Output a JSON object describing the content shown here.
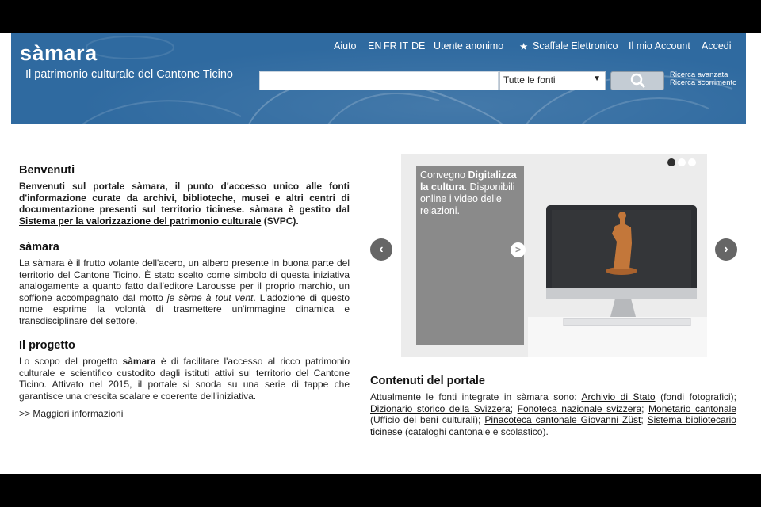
{
  "header": {
    "logo": "sàmara",
    "tagline": "Il patrimonio culturale del Cantone Ticino",
    "nav": {
      "aiuto": "Aiuto",
      "lang_en": "EN",
      "lang_fr": "FR",
      "lang_it": "IT",
      "lang_de": "DE",
      "user": "Utente anonimo",
      "shelf_icon": "★",
      "shelf": "Scaffale Elettronico",
      "account": "Il mio Account",
      "login": "Accedi"
    },
    "search": {
      "value": "",
      "source_selected": "Tutte le fonti",
      "advanced": "Ricerca avanzata",
      "browse": "Ricerca scorrimento"
    }
  },
  "intro": {
    "title": "Benvenuti",
    "text": "Benvenuti sul portale sàmara, il punto d'accesso unico alle fonti d'informazione curate da archivi, biblioteche, musei e altri centri di documentazione presenti sul territorio ticinese. sàmara è gestito dal",
    "link": "Sistema per la valorizzazione del patrimonio culturale",
    "suffix": " (SVPC)."
  },
  "samara": {
    "title": "sàmara",
    "text_a": "La sàmara è il frutto volante dell'acero, un albero presente in buona parte del territorio del Cantone Ticino. È stato scelto come simbolo di questa iniziativa analogamente a quanto fatto dall'editore Larousse per il proprio marchio, un soffione accompagnato dal motto ",
    "motto": "je sème à tout vent",
    "text_b": ". L'adozione di questo nome esprime la volontà di trasmettere un'immagine dinamica e transdisciplinare del settore."
  },
  "project": {
    "title": "Il progetto",
    "text_a": "Lo scopo del progetto ",
    "brand": "sàmara",
    "text_b": " è di facilitare l'accesso al ricco patrimonio culturale e scientifico custodito dagli istituti attivi sul territorio del Cantone Ticino. Attivato nel 2015, il portale si snoda su una serie di tappe che garantisce una crescita scalare e coerente dell'iniziativa.",
    "more": ">> Maggiori informazioni"
  },
  "carousel": {
    "caption_a": "Convegno ",
    "caption_bold": "Digitalizza la cultura",
    "caption_b": ". Disponibili online i video delle relazioni.",
    "go": ">",
    "prev": "‹",
    "next": "›",
    "active_slide": 1,
    "total_slides": 3
  },
  "portal": {
    "title": "Contenuti del portale",
    "p1": "Attualmente le fonti integrate in sàmara sono: ",
    "l1": "Archivio di Stato",
    "p2": " (fondi fotografici); ",
    "l2": "Dizionario storico della Svizzera",
    "p3": "; ",
    "l3": "Fonoteca nazionale svizzera",
    "p4": "; ",
    "l4": "Monetario cantonale",
    "p5": " (Ufficio dei beni culturali); ",
    "l5": "Pinacoteca cantonale Giovanni Züst",
    "p6": "; ",
    "l6": "Sistema bibliotecario ticinese",
    "p7": " (cataloghi cantonale e scolastico)."
  },
  "colors": {
    "banner": "#2f6aa0",
    "lang_active": "#ffd400",
    "caption_bg": "#8a8a8a"
  }
}
